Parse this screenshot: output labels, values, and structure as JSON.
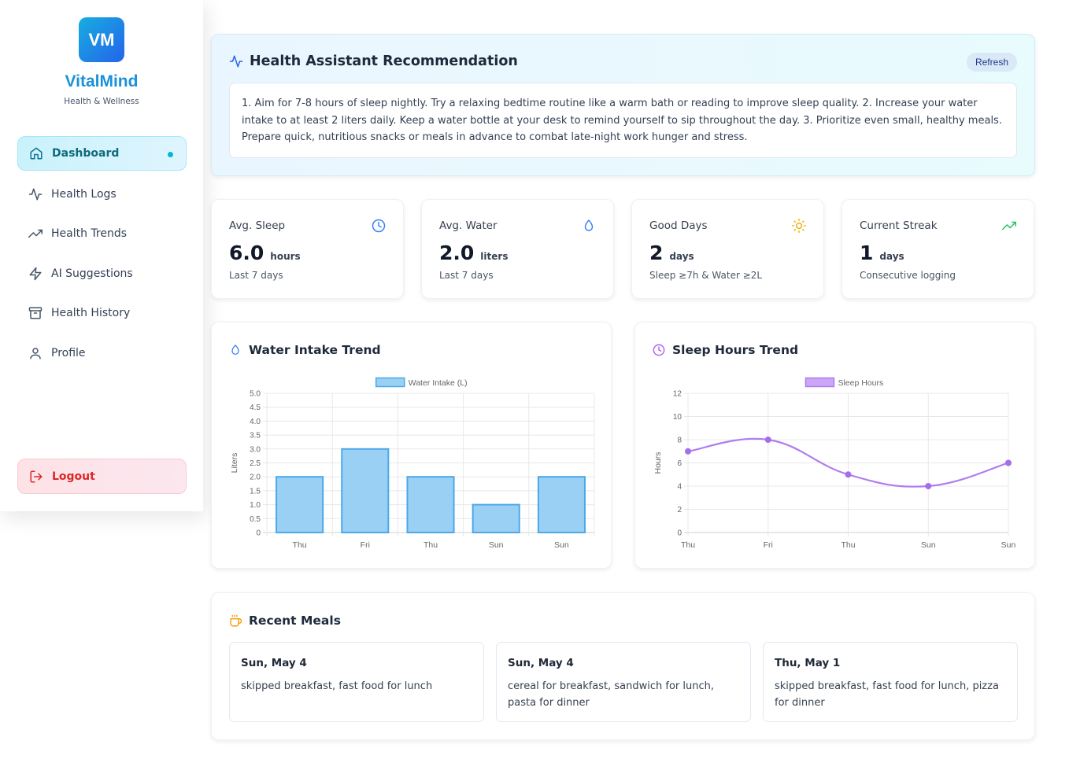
{
  "brand": {
    "logo_text": "VM",
    "name": "VitalMind",
    "tagline": "Health & Wellness"
  },
  "sidebar": {
    "items": [
      {
        "label": "Dashboard",
        "icon": "home-icon",
        "active": true
      },
      {
        "label": "Health Logs",
        "icon": "activity-icon"
      },
      {
        "label": "Health Trends",
        "icon": "trending-up-icon"
      },
      {
        "label": "AI Suggestions",
        "icon": "zap-icon"
      },
      {
        "label": "Health History",
        "icon": "archive-icon"
      },
      {
        "label": "Profile",
        "icon": "user-icon"
      }
    ],
    "logout_label": "Logout"
  },
  "recommendation": {
    "title": "Health Assistant Recommendation",
    "refresh_label": "Refresh",
    "text": "1. Aim for 7-8 hours of sleep nightly. Try a relaxing bedtime routine like a warm bath or reading to improve sleep quality. 2. Increase your water intake to at least 2 liters daily. Keep a water bottle at your desk to remind yourself to sip throughout the day. 3. Prioritize even small, healthy meals. Prepare quick, nutritious snacks or meals in advance to combat late-night work hunger and stress."
  },
  "stats": [
    {
      "label": "Avg. Sleep",
      "value": "6.0",
      "unit": "hours",
      "sub": "Last 7 days",
      "icon": "clock-icon",
      "color": "#3b82f6"
    },
    {
      "label": "Avg. Water",
      "value": "2.0",
      "unit": "liters",
      "sub": "Last 7 days",
      "icon": "droplet-icon",
      "color": "#3b82f6"
    },
    {
      "label": "Good Days",
      "value": "2",
      "unit": "days",
      "sub": "Sleep ≥7h & Water ≥2L",
      "icon": "sun-icon",
      "color": "#eab308"
    },
    {
      "label": "Current Streak",
      "value": "1",
      "unit": "days",
      "sub": "Consecutive logging",
      "icon": "trending-up-icon",
      "color": "#22c55e"
    }
  ],
  "charts": {
    "water": {
      "title": "Water Intake Trend",
      "icon": "droplet-icon"
    },
    "sleep": {
      "title": "Sleep Hours Trend",
      "icon": "clock-icon"
    }
  },
  "chart_data": [
    {
      "type": "bar",
      "title": "",
      "categories": [
        "Thu",
        "Fri",
        "Thu",
        "Sun",
        "Sun"
      ],
      "series": [
        {
          "name": "Water Intake (L)",
          "values": [
            2,
            3,
            2,
            1,
            2
          ]
        }
      ],
      "xlabel": "",
      "ylabel": "Liters",
      "ylim": [
        0,
        5
      ],
      "yticks": [
        "0",
        "0.5",
        "1.0",
        "1.5",
        "2.0",
        "2.5",
        "3.0",
        "3.5",
        "4.0",
        "4.5",
        "5.0"
      ],
      "grid": true,
      "legend": "top-center",
      "colors": {
        "fill": "#9bd0f5",
        "stroke": "#4aa8e8"
      }
    },
    {
      "type": "line",
      "title": "",
      "categories": [
        "Thu",
        "Fri",
        "Thu",
        "Sun",
        "Sun"
      ],
      "series": [
        {
          "name": "Sleep Hours",
          "values": [
            7,
            8,
            5,
            4,
            6
          ]
        }
      ],
      "xlabel": "",
      "ylabel": "Hours",
      "ylim": [
        0,
        12
      ],
      "yticks": [
        "0",
        "2",
        "4",
        "6",
        "8",
        "10",
        "12"
      ],
      "grid": true,
      "legend": "top-center",
      "colors": {
        "line": "#b07cf0",
        "fill": "#c9a6f7",
        "point": "#a56ee8"
      }
    }
  ],
  "meals": {
    "title": "Recent Meals",
    "items": [
      {
        "date": "Sun, May 4",
        "text": "skipped breakfast, fast food for lunch"
      },
      {
        "date": "Sun, May 4",
        "text": "cereal for breakfast, sandwich for lunch, pasta for dinner"
      },
      {
        "date": "Thu, May 1",
        "text": "skipped breakfast, fast food for lunch, pizza for dinner"
      }
    ]
  }
}
